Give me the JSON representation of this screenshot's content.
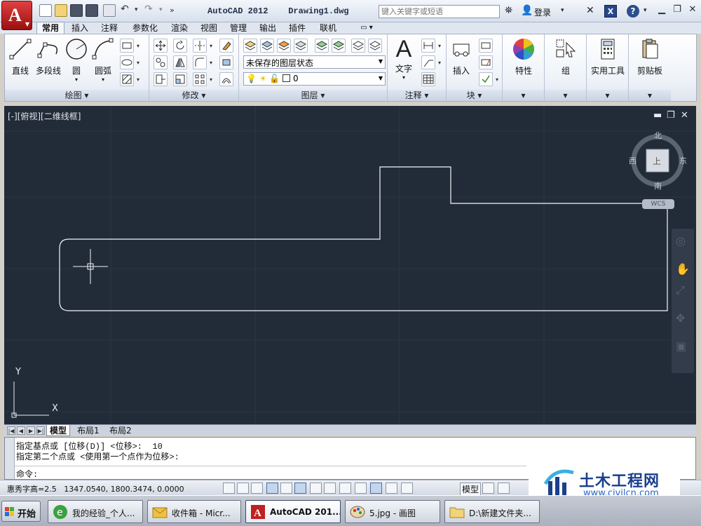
{
  "titlebar": {
    "app_title": "AutoCAD 2012    Drawing1.dwg",
    "search_placeholder": "键入关键字或短语",
    "login_label": "登录",
    "help_glyph": "?",
    "exchange_glyph": "X"
  },
  "ribbon_tabs": [
    "常用",
    "插入",
    "注释",
    "参数化",
    "渲染",
    "视图",
    "管理",
    "输出",
    "插件",
    "联机"
  ],
  "ribbon": {
    "draw": {
      "label": "绘图 ▾",
      "tools": [
        "直线",
        "多段线",
        "圆",
        "圆弧"
      ]
    },
    "modify": {
      "label": "修改 ▾"
    },
    "layers": {
      "label": "图层 ▾",
      "state_combo": "未保存的图层状态",
      "layer_combo": "0"
    },
    "annotation": {
      "label": "注释 ▾",
      "text_tool": "文字"
    },
    "block": {
      "label": "块 ▾",
      "insert_tool": "插入"
    },
    "properties_tool": "特性",
    "group_tool": "组",
    "utilities_tool": "实用工具",
    "clipboard_tool": "剪贴板"
  },
  "viewport": {
    "label": "[-][俯视][二维线框]",
    "compass": {
      "north": "北",
      "south": "南",
      "east": "东",
      "west": "西",
      "top_face": "上"
    },
    "wcs": "WCS",
    "ucs_y": "Y",
    "ucs_x": "X"
  },
  "layout_tabs": [
    "模型",
    "布局1",
    "布局2"
  ],
  "command": {
    "line1": "指定基点或 [位移(D)] <位移>:  10",
    "line2": "指定第二个点或 <使用第一个点作为位移>:",
    "prompt": "命令:"
  },
  "status": {
    "coords": "惠秀字高=2.5   1347.0540, 1800.3474, 0.0000",
    "model_label": "模型"
  },
  "watermark": {
    "title": "土木工程网",
    "url": "www.civilcn.com"
  },
  "taskbar": {
    "start": "开始",
    "tasks": [
      "我的经验_个人...",
      "收件箱 - Micr...",
      "AutoCAD 201...",
      "5.jpg - 画图",
      "D:\\新建文件夹..."
    ]
  }
}
